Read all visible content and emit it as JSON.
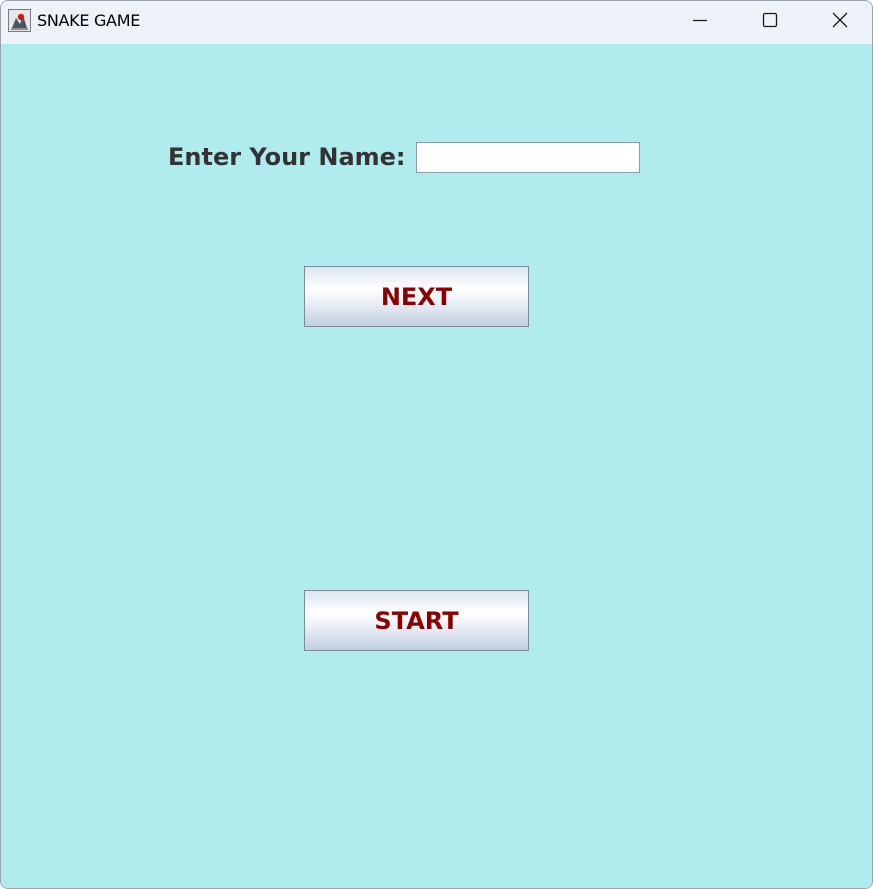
{
  "window": {
    "title": "SNAKE GAME",
    "app_icon": "java-duke-icon",
    "controls": {
      "minimize_icon": "minimize-icon",
      "maximize_icon": "maximize-icon",
      "close_icon": "close-icon"
    }
  },
  "form": {
    "name_label": "Enter Your Name:",
    "name_value": "",
    "name_placeholder": ""
  },
  "buttons": {
    "next_label": "NEXT",
    "start_label": "START"
  },
  "colors": {
    "background": "#b0ecee",
    "titlebar": "#eef2f9",
    "label_text": "#333333",
    "button_text": "#8b0000"
  }
}
